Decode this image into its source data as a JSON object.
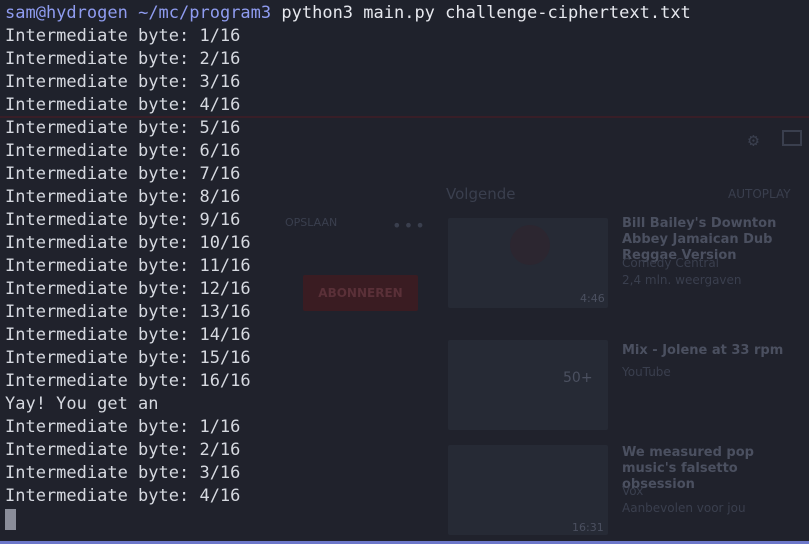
{
  "terminal": {
    "prompt_user_host": "sam@hydrogen",
    "prompt_path": "~/mc/program3",
    "command": "python3 main.py challenge-ciphertext.txt",
    "output_lines": [
      "Intermediate byte: 1/16",
      "Intermediate byte: 2/16",
      "Intermediate byte: 3/16",
      "Intermediate byte: 4/16",
      "Intermediate byte: 5/16",
      "Intermediate byte: 6/16",
      "Intermediate byte: 7/16",
      "Intermediate byte: 8/16",
      "Intermediate byte: 9/16",
      "Intermediate byte: 10/16",
      "Intermediate byte: 11/16",
      "Intermediate byte: 12/16",
      "Intermediate byte: 13/16",
      "Intermediate byte: 14/16",
      "Intermediate byte: 15/16",
      "Intermediate byte: 16/16",
      "Yay! You get an",
      "Intermediate byte: 1/16",
      "Intermediate byte: 2/16",
      "Intermediate byte: 3/16",
      "Intermediate byte: 4/16"
    ]
  },
  "background_window": {
    "up_next_label": "Volgende",
    "autoplay_label": "AUTOPLAY",
    "save_label": "OPSLAAN",
    "subscribe_label": "ABONNEREN",
    "videos": [
      {
        "title": "Bill Bailey's Downton Abbey Jamaican Dub Reggae Version",
        "channel": "Comedy Central",
        "meta": "2,4 mln. weergaven",
        "duration": "4:46"
      },
      {
        "title": "Mix - Jolene at 33 rpm",
        "channel": "YouTube",
        "meta": "",
        "duration": "50+"
      },
      {
        "title": "We measured pop music's falsetto obsession",
        "channel": "Vox",
        "meta": "Aanbevolen voor jou",
        "duration": "16:31"
      }
    ]
  },
  "colors": {
    "background": "#1f222c",
    "text": "#d6d9e0",
    "prompt": "#8f9cf0",
    "cursor": "#8a8d99",
    "bottom_bar": "#6c77c9"
  }
}
